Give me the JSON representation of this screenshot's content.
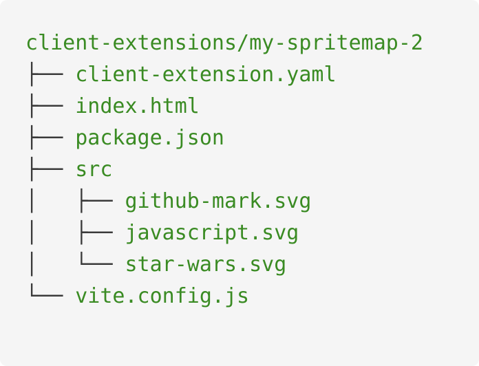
{
  "tree": {
    "root": "client-extensions/my-spritemap-2",
    "entries": [
      {
        "prefix": "├── ",
        "name": "client-extension.yaml"
      },
      {
        "prefix": "├── ",
        "name": "index.html"
      },
      {
        "prefix": "├── ",
        "name": "package.json"
      },
      {
        "prefix": "├── ",
        "name": "src"
      },
      {
        "prefix": "│   ├── ",
        "name": "github-mark.svg"
      },
      {
        "prefix": "│   ├── ",
        "name": "javascript.svg"
      },
      {
        "prefix": "│   └── ",
        "name": "star-wars.svg"
      },
      {
        "prefix": "└── ",
        "name": "vite.config.js"
      }
    ]
  },
  "colors": {
    "background": "#f5f5f5",
    "text": "#3a8b23",
    "branch": "#3a3a3a"
  }
}
